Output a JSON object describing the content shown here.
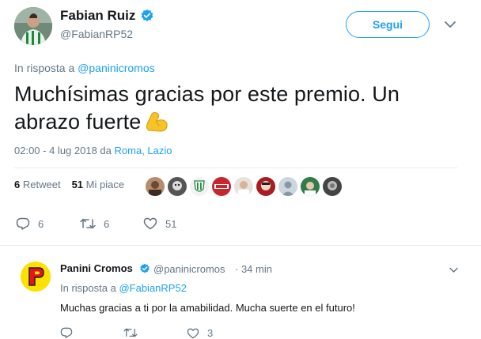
{
  "tweet": {
    "display_name": "Fabian Ruiz",
    "handle": "@FabianRP52",
    "follow_label": "Segui",
    "reply_prefix": "In risposta a",
    "reply_mention": "@paninicromos",
    "text": "Muchísimas gracias por este premio. Un abrazo fuerte",
    "emoji": "flexed-biceps-emoji",
    "timestamp": "02:00 - 4 lug 2018 da",
    "place": "Roma, Lazio",
    "retweets_count": "6",
    "retweets_label": "Retweet",
    "likes_count": "51",
    "likes_label": "Mi piace",
    "actions": {
      "reply_count": "6",
      "retweet_count": "6",
      "like_count": "51"
    }
  },
  "reply": {
    "display_name": "Panini Cromos",
    "handle": "@paninicromos",
    "time": "· 34 min",
    "reply_prefix": "In risposta a",
    "reply_mention": "@FabianRP52",
    "text": "Muchas gracias a ti por la amabilidad. Mucha suerte en el futuro!",
    "actions": {
      "like_count": "3"
    }
  },
  "colors": {
    "accent": "#1da1f2",
    "muted": "#657786",
    "text": "#14171a",
    "divider": "#e6ecf0"
  }
}
